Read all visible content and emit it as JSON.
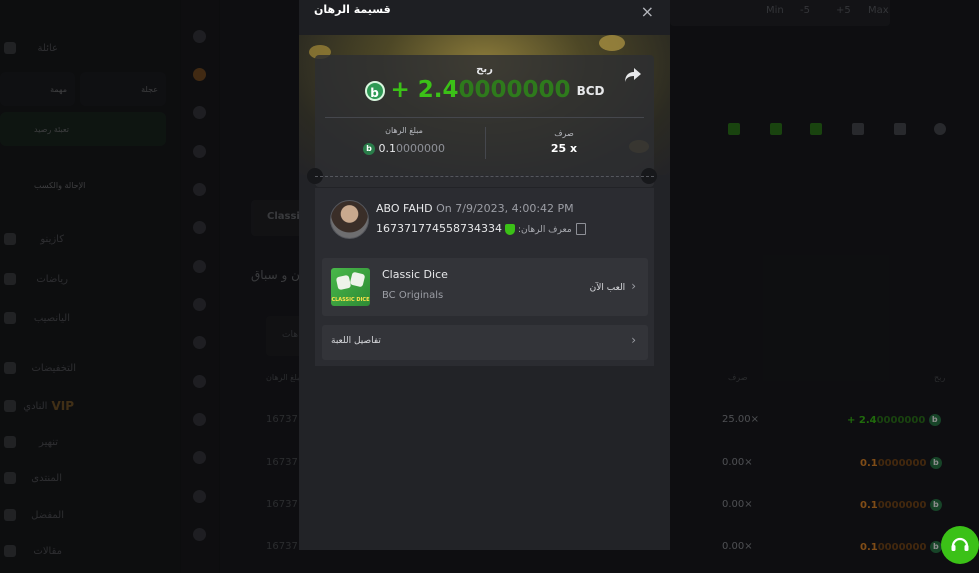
{
  "sidebar": {
    "items": [
      {
        "label": "عائلة",
        "icon": "gift-icon"
      },
      {
        "label": "كازينو",
        "icon": "casino-icon"
      },
      {
        "label": "رياضات",
        "icon": "sports-icon"
      },
      {
        "label": "اليانصيب",
        "icon": "lottery-icon"
      },
      {
        "label": "التخفيضات",
        "icon": "promo-icon"
      },
      {
        "label": "النادي",
        "badge": "VIP",
        "icon": "vip-icon"
      },
      {
        "label": "تنهير",
        "icon": "spin-icon"
      },
      {
        "label": "المنتدى",
        "icon": "forum-icon"
      },
      {
        "label": "المفضل",
        "icon": "favorites-icon"
      },
      {
        "label": "مقالات",
        "icon": "articles-icon"
      }
    ],
    "cards": {
      "quest": "مهمة",
      "wheel": "عجلة",
      "recharge": "تعبئة رصيد",
      "referral": "الإحالة والكسب"
    }
  },
  "background": {
    "top_buttons": [
      "Min",
      "-5",
      "+5",
      "Max"
    ],
    "tab_fragment": "Classi",
    "section_title_fragment": "ن و سباق",
    "tab_label_fragment": "هات",
    "table": {
      "headers": {
        "bet_amount": "مبلغ الرهان",
        "payout": "صرف",
        "profit": "ربح"
      },
      "rows": [
        {
          "bet_id": "16737",
          "payout": "25.00×",
          "profit_main": "+ 2.4",
          "profit_faded": "0000000",
          "positive": true
        },
        {
          "bet_id": "16737",
          "payout": "0.00×",
          "profit_main": "0.1",
          "profit_faded": "0000000",
          "positive": false
        },
        {
          "bet_id": "16737",
          "payout": "0.00×",
          "profit_main": "0.1",
          "profit_faded": "0000000",
          "positive": false
        },
        {
          "bet_id": "16737",
          "payout": "0.00×",
          "profit_main": "0.1",
          "profit_faded": "0000000",
          "positive": false
        }
      ]
    }
  },
  "modal": {
    "title": "قسيمة الرهان",
    "close": "×",
    "win_label": "ربح",
    "win_amount_main": "+ 2.4",
    "win_amount_faded": "0000000",
    "currency": "BCD",
    "coin_glyph": "b",
    "payout_label": "صرف",
    "payout_value": "25 x",
    "bet_amount_label": "مبلغ الرهان",
    "bet_amount_main": "0.1",
    "bet_amount_faded": "0000000",
    "username": "ABO FAHD",
    "date": "On 7/9/2023, 4:00:42 PM",
    "bet_id_label": "معرف الرهان:",
    "bet_id": "167371774558734334",
    "game_name": "Classic Dice",
    "game_provider": "BC Originals",
    "game_thumb_caption": "CLASSIC DICE",
    "play_now": "العب الآن",
    "game_details": "تفاصيل اللعبة"
  },
  "colors": {
    "accent_green": "#3bc117",
    "loss_orange": "#e88b2a",
    "background": "#17181b"
  }
}
